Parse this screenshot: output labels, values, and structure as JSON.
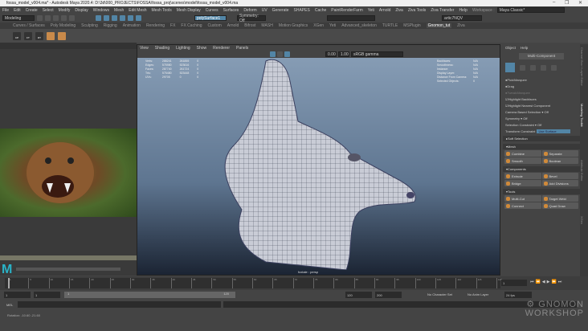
{
  "window": {
    "title": "fossa_model_v004.ma* - Autodesk Maya 2020.4: D:\\3d\\000_PROJECTS\\FOSSA\\fossa_proj\\scenes\\model\\fossa_model_v004.ma",
    "min": "–",
    "max": "❐",
    "close": "✕"
  },
  "menu": [
    "File",
    "Edit",
    "Create",
    "Select",
    "Modify",
    "Display",
    "Windows",
    "Mesh",
    "Edit Mesh",
    "Mesh Tools",
    "Mesh Display",
    "Curves",
    "Surfaces",
    "Deform",
    "UV",
    "Generate",
    "SHAPES",
    "Cache",
    "PaintRenderFarm",
    "Yeti",
    "Arnold",
    "Ziva",
    "Ziva Tools",
    "Ziva Transfer",
    "Help"
  ],
  "workspace": {
    "label": "Workspace :",
    "value": "Maya Classic*"
  },
  "status": {
    "mode": "Modeling",
    "live_surface": "polySurface1",
    "symmetry": "Symmetry: Off",
    "user": "artic7NQV"
  },
  "shelf_tabs": [
    "Curves / Surfaces",
    "Poly Modeling",
    "Sculpting",
    "Rigging",
    "Animation",
    "Rendering",
    "FX",
    "FX Caching",
    "Custom",
    "Arnold",
    "Bifrost",
    "MASH",
    "Motion Graphics",
    "XGen",
    "Yeti",
    "Advanced_skeleton",
    "TURTLE",
    "MSPlugin",
    "Gnomon_tut",
    "Ziva"
  ],
  "shelf_active": "Gnomon_tut",
  "shelf_items": [
    "CP",
    "FT",
    "RT"
  ],
  "viewport": {
    "menu": [
      "View",
      "Shading",
      "Lighting",
      "Show",
      "Renderer",
      "Panels"
    ],
    "exposure": "0.00",
    "gamma": "1.00",
    "colorspace": "sRGB gamma",
    "stats_left": [
      [
        "Verts:",
        "288241",
        "261855",
        "0"
      ],
      [
        "Edges:",
        "575980",
        "523616",
        "0"
      ],
      [
        "Faces:",
        "287740",
        "261724",
        "0"
      ],
      [
        "Tris:",
        "575480",
        "523448",
        "0"
      ],
      [
        "UVs:",
        "29705",
        "0",
        "0"
      ]
    ],
    "stats_right": [
      [
        "Backfaces:",
        "N/A"
      ],
      [
        "Smoothness:",
        "N/A"
      ],
      [
        "Instance:",
        "N/A"
      ],
      [
        "Display Layer:",
        "N/A"
      ],
      [
        "Distance From Camera:",
        "N/A"
      ],
      [
        "Selected Objects:",
        "0"
      ]
    ],
    "camera": "foxtale : persp"
  },
  "toolkit": {
    "menu": [
      "Object",
      "Help"
    ],
    "multi_component": "Multi-Component",
    "pick": "Pick/Marquee",
    "drag": "Drag",
    "tweak": "Tweak/Marquee",
    "highlight_backfaces": "Highlight Backfaces",
    "highlight_nearest": "Highlight Nearest Component",
    "camera_based": "Camera Based Selection",
    "camera_based_value": "Off",
    "symmetry": "Symmetry",
    "symmetry_value": "Off",
    "selection_constraint": "Selection Constraint",
    "selection_constraint_value": "Off",
    "transform_constraint": "Transform Constraint",
    "transform_constraint_value": "Use Surface",
    "soft_selection": "Soft Selection",
    "mesh_header": "Mesh",
    "mesh": [
      "Combine",
      "Separate",
      "Smooth",
      "Boolean"
    ],
    "components_header": "Components",
    "components": [
      "Extrude",
      "Bevel",
      "Bridge",
      "Add Divisions"
    ],
    "tools_header": "Tools",
    "tools": [
      "Multi-Cut",
      "Target Weld",
      "Connect",
      "Quad Draw"
    ]
  },
  "side_tabs": [
    "Channel Box / Layer Editor",
    "Modeling Toolkit",
    "Attribute Editor",
    "XGen"
  ],
  "timeline": {
    "ticks": [
      "1",
      "5",
      "10",
      "15",
      "20",
      "25",
      "30",
      "35",
      "40",
      "45",
      "50",
      "55",
      "60",
      "65",
      "70",
      "75",
      "80",
      "85",
      "90",
      "95",
      "100",
      "105",
      "110",
      "115",
      "120"
    ],
    "current": "1"
  },
  "range": {
    "start": "1",
    "inner_start": "1",
    "slider_start": "1",
    "slider_end": "120",
    "end": "120",
    "outer_end": "200",
    "character_set": "No Character Set",
    "anim_layer": "No Anim Layer",
    "fps": "24 fps"
  },
  "mel": {
    "label": "MEL"
  },
  "help": {
    "text": "Rotation: -10.60 -21.60"
  },
  "watermark": "THE GNOMON WORKSHOP",
  "colors": {
    "accent": "#5285a6",
    "bg": "#444444"
  }
}
